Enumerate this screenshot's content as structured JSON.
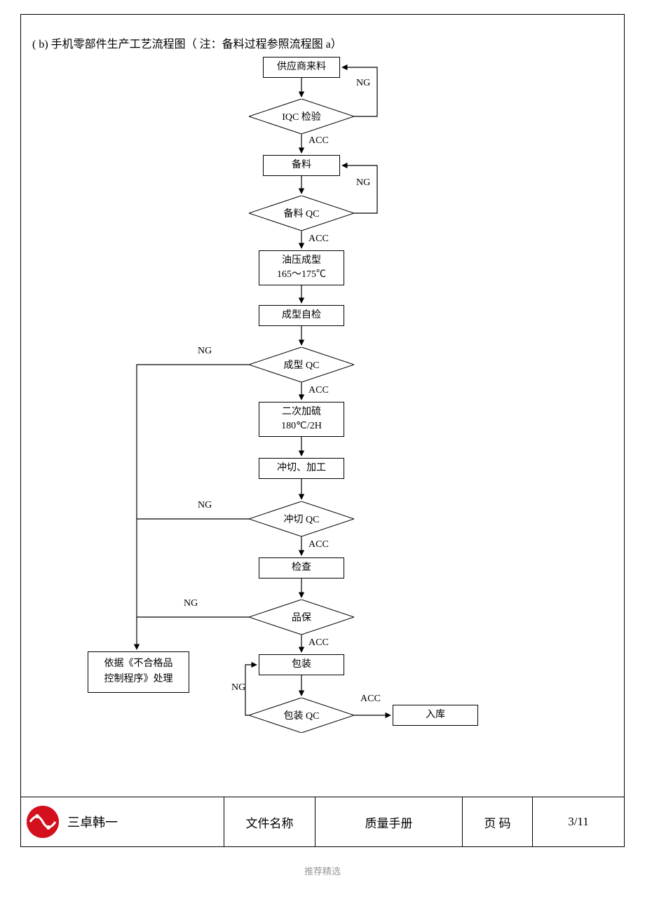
{
  "title": "( b) 手机零部件生产工艺流程图（ 注：备料过程参照流程图 a）",
  "nodes": {
    "supplier": "供应商来料",
    "iqc": "IQC 检验",
    "prep": "备料",
    "prep_qc": "备料 QC",
    "hydraulic_l1": "油压成型",
    "hydraulic_l2": "165～175℃",
    "self_check": "成型自检",
    "mold_qc": "成型 QC",
    "vulcan_l1": "二次加硫",
    "vulcan_l2": "180℃/2H",
    "punch": "冲切、加工",
    "punch_qc": "冲切 QC",
    "inspect": "检查",
    "qa": "品保",
    "pack": "包装",
    "pack_qc": "包装 QC",
    "warehouse": "入库",
    "nonconform_l1": "依据《不合格品",
    "nonconform_l2": "控制程序》处理"
  },
  "labels": {
    "ng": "NG",
    "acc": "ACC"
  },
  "footer": {
    "company": "三卓韩一",
    "doc_name_label": "文件名称",
    "doc_name_value": "质量手册",
    "page_label": "页    码",
    "page_value": "3/11"
  },
  "bottom_note": "推荐精选"
}
